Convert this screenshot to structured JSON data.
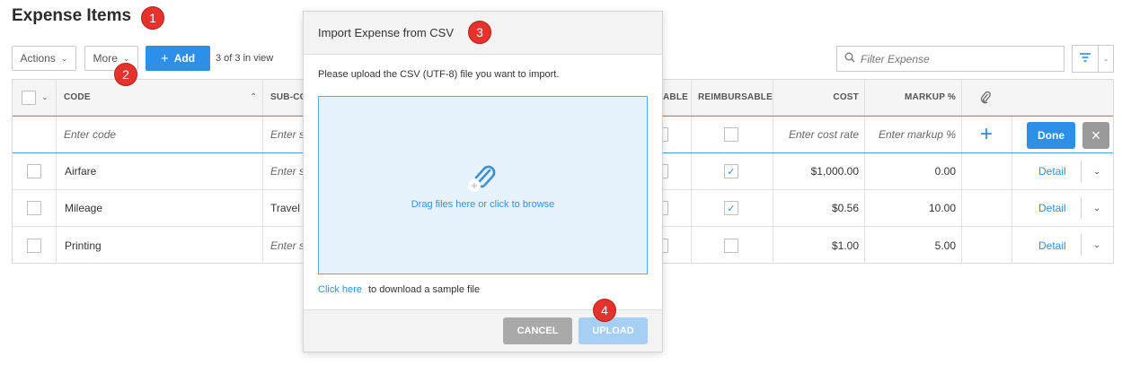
{
  "page": {
    "title": "Expense Items"
  },
  "toolbar": {
    "actions_label": "Actions",
    "more_label": "More",
    "add_label": "Add",
    "view_count": "3 of 3 in view"
  },
  "filter": {
    "placeholder": "Filter Expense"
  },
  "grid": {
    "headers": {
      "code": "CODE",
      "sub_code": "SUB-CO",
      "billable_tail": "ABLE",
      "reimbursable": "REIMBURSABLE",
      "cost": "COST",
      "markup": "MARKUP %"
    },
    "edit_row": {
      "code_placeholder": "Enter code",
      "sub_code_placeholder": "Enter s",
      "cost_placeholder": "Enter cost rate",
      "markup_placeholder": "Enter markup %",
      "done_label": "Done"
    },
    "rows": [
      {
        "code": "Airfare",
        "sub_code": "Enter s",
        "sub_code_placeholder": true,
        "reimbursable": true,
        "cost": "$1,000.00",
        "markup": "0.00",
        "detail": "Detail"
      },
      {
        "code": "Mileage",
        "sub_code": "Travel",
        "sub_code_placeholder": false,
        "reimbursable": true,
        "cost": "$0.56",
        "markup": "10.00",
        "detail": "Detail"
      },
      {
        "code": "Printing",
        "sub_code": "Enter s",
        "sub_code_placeholder": true,
        "reimbursable": false,
        "cost": "$1.00",
        "markup": "5.00",
        "detail": "Detail"
      }
    ]
  },
  "modal": {
    "title": "Import Expense from CSV",
    "description": "Please upload the CSV (UTF-8) file you want to import.",
    "dropzone_text": "Drag files here or click to browse",
    "sample_link": "Click here",
    "sample_text": "to download a sample file",
    "cancel_label": "CANCEL",
    "upload_label": "UPLOAD"
  },
  "callouts": [
    "1",
    "2",
    "3",
    "4"
  ],
  "colors": {
    "accent": "#2d8fe8",
    "callout": "#e5322d",
    "upload_disabled": "#a6cff4",
    "cancel": "#a9a9a9"
  },
  "icons": [
    "chevron-down-icon",
    "plus-icon",
    "search-icon",
    "filter-icon",
    "paperclip-icon",
    "checkmark-icon",
    "close-icon",
    "chevron-up-icon"
  ]
}
